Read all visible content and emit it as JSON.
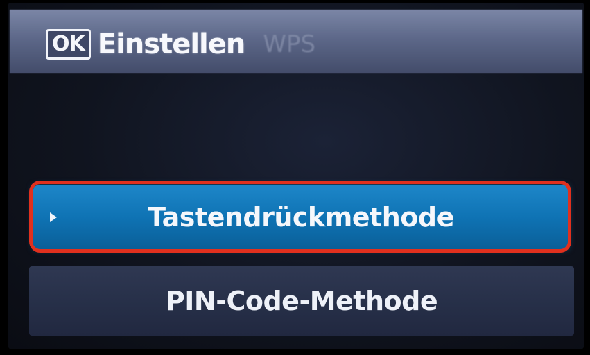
{
  "header": {
    "ok_key_label": "OK",
    "title": "Einstellen",
    "mode": "WPS"
  },
  "options": [
    {
      "label": "Tastendrückmethode",
      "selected": true
    },
    {
      "label": "PIN-Code-Methode",
      "selected": false
    }
  ],
  "colors": {
    "header_bar": "#5d6889",
    "selected_item": "#0f73b4",
    "normal_item": "#273049",
    "highlight_ring": "#e0301e",
    "screen_background": "#10141f"
  },
  "icons": {
    "selection_indicator": "play-arrow-icon"
  }
}
